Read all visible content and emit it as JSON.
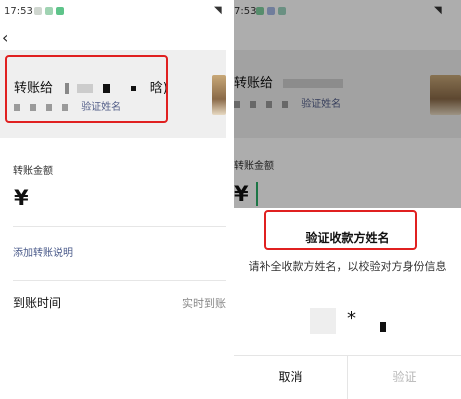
{
  "left": {
    "status": {
      "time": "17:53",
      "dots": [
        "#cfd6cf",
        "#9fd3b2",
        "#5ec48a"
      ]
    },
    "header": {
      "prefix": "转账给",
      "name_suffix": "晗)",
      "verify_link": "验证姓名"
    },
    "amount": {
      "label": "转账金额",
      "currency": "¥"
    },
    "note_link": "添加转账说明",
    "arrival": {
      "label": "到账时间",
      "value": "实时到账"
    }
  },
  "right": {
    "status": {
      "time": "7:53",
      "dots": [
        "#7fd0a0",
        "#a6b8e6",
        "#9cd4c0"
      ]
    },
    "header": {
      "prefix": "转账给",
      "verify_link": "验证姓名"
    },
    "amount": {
      "label": "转账金额",
      "currency": "¥"
    },
    "dialog": {
      "title": "验证收款方姓名",
      "message": "请补全收款方姓名，以校验对方身份信息",
      "masked_char": "*",
      "cancel": "取消",
      "confirm": "验证"
    }
  },
  "colors": {
    "highlight": "#e02020",
    "link": "#55608a",
    "disabled": "#b7b7b7"
  }
}
